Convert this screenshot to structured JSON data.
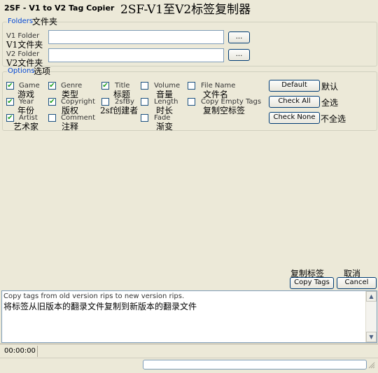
{
  "window": {
    "title_en": "2SF - V1 to V2 Tag Copier",
    "title_cn": "2SF-V1至V2标签复制器"
  },
  "folders": {
    "legend": "Folders",
    "legend_cn": "文件夹",
    "v1_label": "V1 Folder",
    "v1_label_cn": "V1文件夹",
    "v1_value": "",
    "v2_label": "V2 Folder",
    "v2_label_cn": "V2文件夹",
    "v2_value": "",
    "browse_label": "..."
  },
  "options": {
    "legend": "Options",
    "legend_cn": "选项",
    "checkboxes": [
      {
        "label": "Game",
        "cn": "游戏",
        "checked": true
      },
      {
        "label": "Year",
        "cn": "年份",
        "checked": true
      },
      {
        "label": "Artist",
        "cn": "艺术家",
        "checked": true
      },
      {
        "label": "Genre",
        "cn": "类型",
        "checked": true
      },
      {
        "label": "Copyright",
        "cn": "版权",
        "checked": true
      },
      {
        "label": "Comment",
        "cn": "注释",
        "checked": false
      },
      {
        "label": "Title",
        "cn": "标题",
        "checked": true
      },
      {
        "label": "2sfBy",
        "cn": "2sf创建者",
        "checked": false
      },
      {
        "label": "Volume",
        "cn": "音量",
        "checked": false
      },
      {
        "label": "Length",
        "cn": "时长",
        "checked": false
      },
      {
        "label": "Fade",
        "cn": "渐变",
        "checked": false
      },
      {
        "label": "File Name",
        "cn": "文件名",
        "checked": false
      },
      {
        "label": "Copy Empty Tags",
        "cn": "复制空标签",
        "checked": false
      }
    ],
    "default_label": "Default",
    "default_cn": "默认",
    "check_all_label": "Check All",
    "check_all_cn": "全选",
    "check_none_label": "Check None",
    "check_none_cn": "不全选"
  },
  "actions": {
    "copy_label": "Copy Tags",
    "copy_cn": "复制标签",
    "cancel_label": "Cancel",
    "cancel_cn": "取消"
  },
  "log": {
    "line_en": "Copy tags from old version rips to new version rips.",
    "line_cn": "将标签从旧版本的翻录文件复制到新版本的翻录文件"
  },
  "status": {
    "time": "00:00:00",
    "progress": 0
  }
}
